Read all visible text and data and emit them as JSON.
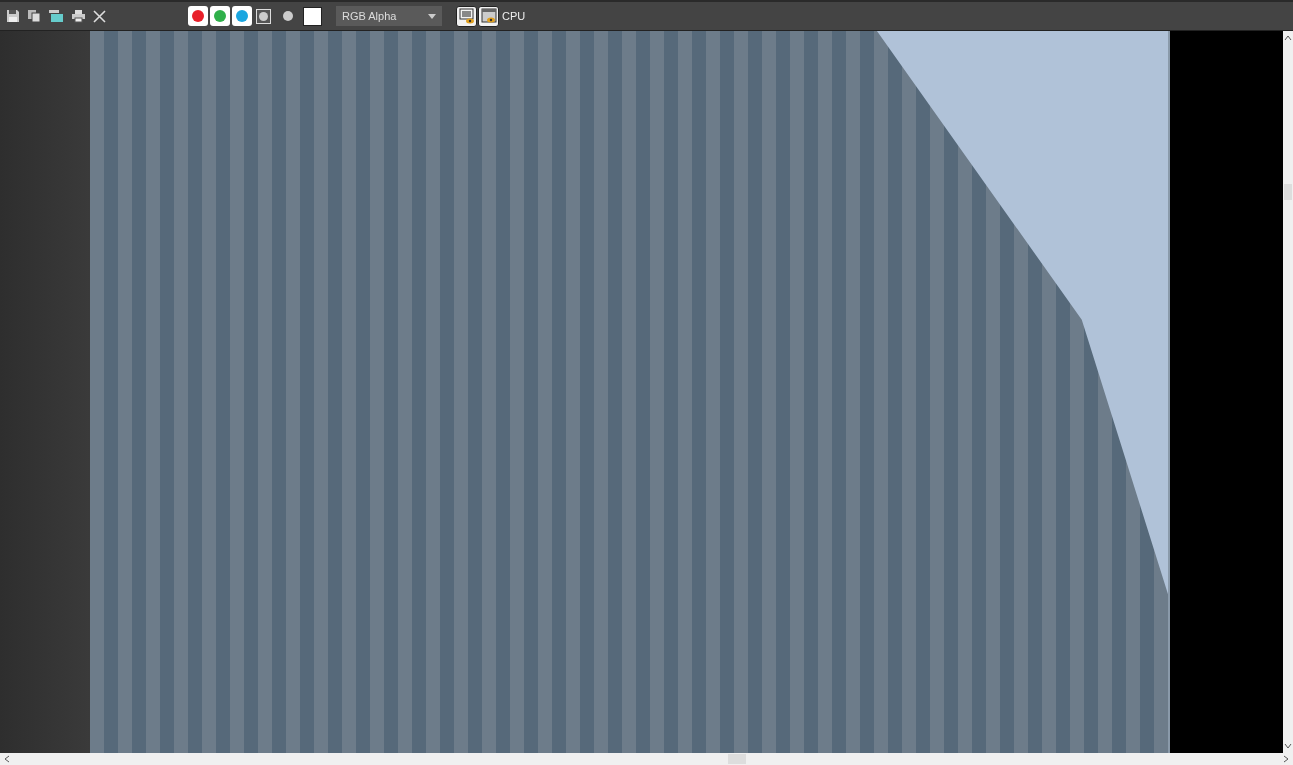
{
  "channels": [
    {
      "kind": "red",
      "selected": true
    },
    {
      "kind": "green",
      "selected": true
    },
    {
      "kind": "blue",
      "selected": true
    },
    {
      "kind": "alpha",
      "selected": false
    }
  ],
  "display_mode": {
    "value": "RGB Alpha"
  },
  "render_mode": {
    "label": "CPU"
  }
}
